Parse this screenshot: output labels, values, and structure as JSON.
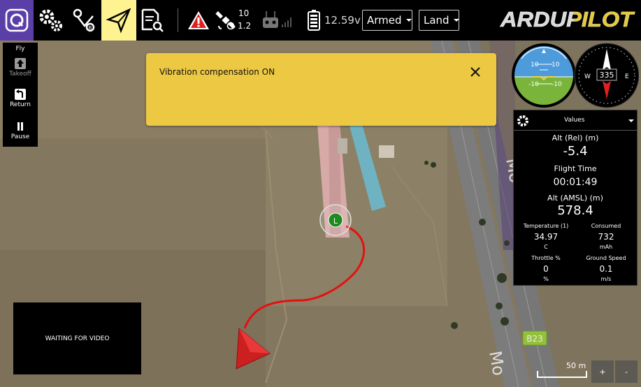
{
  "toolbar": {
    "satellite_count": "10",
    "hdop": "1.2",
    "battery_voltage": "12.59v",
    "arm_state": "Armed",
    "flight_mode": "Land",
    "logo_text": "ARDUPILOT"
  },
  "fly_tools": {
    "header": "Fly",
    "takeoff_label": "Takeoff",
    "return_label": "Return",
    "pause_label": "Pause"
  },
  "notification": {
    "message": "Vibration compensation ON"
  },
  "attitude": {
    "pitch_upper": "10",
    "pitch_lower": "-10"
  },
  "compass": {
    "heading": "335",
    "west": "W",
    "east": "E"
  },
  "values_panel": {
    "title": "Values",
    "alt_rel_label": "Alt (Rel) (m)",
    "alt_rel_value": "-5.4",
    "flight_time_label": "Flight Time",
    "flight_time_value": "00:01:49",
    "alt_amsl_label": "Alt (AMSL) (m)",
    "alt_amsl_value": "578.4",
    "temperature_label": "Temperature (1)",
    "temperature_value": "34.97",
    "temperature_unit": "C",
    "consumed_label": "Consumed",
    "consumed_value": "732",
    "consumed_unit": "mAh",
    "throttle_label": "Throttle %",
    "throttle_value": "0",
    "throttle_unit": "%",
    "ground_speed_label": "Ground Speed",
    "ground_speed_value": "0.1",
    "ground_speed_unit": "m/s"
  },
  "map": {
    "home_marker": "L",
    "road_label": "B23",
    "street_name_top": "Mo",
    "street_name_bottom": "Mo",
    "scale_label": "50 m",
    "zoom_in": "+",
    "zoom_out": "-"
  },
  "video": {
    "status": "WAITING FOR VIDEO"
  },
  "colors": {
    "accent_purple": "#5b3fa8",
    "plan_highlight": "#fff291",
    "warning_red": "#e02020",
    "notification_yellow": "#edc843",
    "flight_path_red": "#e51010",
    "home_green": "#1f8a1f"
  }
}
